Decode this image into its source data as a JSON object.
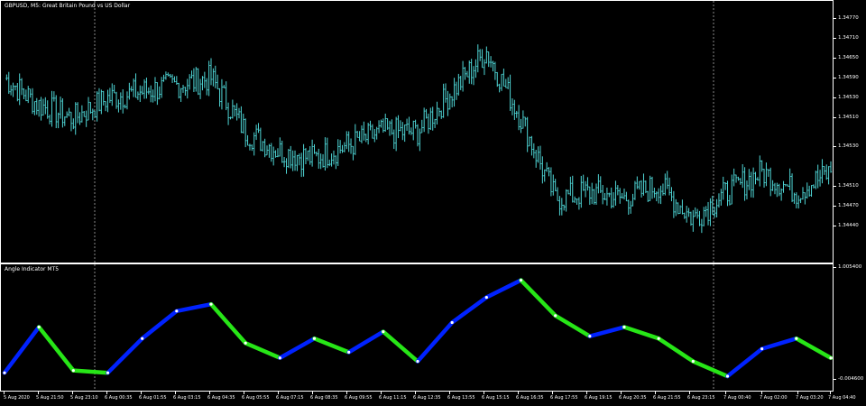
{
  "main_chart": {
    "title": "GBPUSD, M5:  Great Britain Pound vs US Dollar",
    "price_labels": [
      "1.34770",
      "1.34710",
      "1.34650",
      "1.34590",
      "1.34530",
      "1.34510",
      "1.34530",
      "1.34510",
      "1.34470",
      "1.34440"
    ],
    "colors": {
      "candle": "#4fd6d6",
      "background": "#000000",
      "border": "#ffffff",
      "separator": "#c0c0c0"
    }
  },
  "indicator": {
    "title": "Angle Indicator MT5",
    "levels": [
      "1.005400",
      "-0.004600"
    ],
    "colors": {
      "up": "#0022ff",
      "down": "#27e617"
    }
  },
  "time_axis": {
    "labels": [
      "5 Aug 2020",
      "5 Aug 21:50",
      "5 Aug 23:10",
      "6 Aug 00:35",
      "6 Aug 01:55",
      "6 Aug 03:15",
      "6 Aug 04:35",
      "6 Aug 05:55",
      "6 Aug 07:15",
      "6 Aug 08:35",
      "6 Aug 09:55",
      "6 Aug 11:15",
      "6 Aug 12:35",
      "6 Aug 13:55",
      "6 Aug 15:15",
      "6 Aug 16:35",
      "6 Aug 17:55",
      "6 Aug 19:15",
      "6 Aug 20:35",
      "6 Aug 21:55",
      "6 Aug 23:15",
      "7 Aug 00:40",
      "7 Aug 02:00",
      "7 Aug 03:20",
      "7 Aug 04:40"
    ]
  },
  "chart_data": [
    {
      "type": "line",
      "title": "GBPUSD, M5:  Great Britain Pound vs US Dollar",
      "ylim": [
        1.3441,
        1.3479
      ],
      "x": [
        "5 Aug 2020",
        "5 Aug 21:50",
        "5 Aug 23:10",
        "6 Aug 00:35",
        "6 Aug 01:55",
        "6 Aug 03:15",
        "6 Aug 04:35",
        "6 Aug 05:55",
        "6 Aug 07:15",
        "6 Aug 08:35",
        "6 Aug 09:55",
        "6 Aug 11:15",
        "6 Aug 12:35",
        "6 Aug 13:55",
        "6 Aug 15:15",
        "6 Aug 16:35",
        "6 Aug 17:55",
        "6 Aug 19:15",
        "6 Aug 20:35",
        "6 Aug 21:55",
        "6 Aug 23:15",
        "7 Aug 00:40",
        "7 Aug 02:00",
        "7 Aug 03:20",
        "7 Aug 04:40"
      ],
      "series": [
        {
          "values": [
            1.3468,
            1.3464,
            1.3462,
            1.3465,
            1.3466,
            1.3467,
            1.3468,
            1.346,
            1.3457,
            1.3456,
            1.3458,
            1.346,
            1.346,
            1.3466,
            1.3472,
            1.3462,
            1.345,
            1.3451,
            1.345,
            1.3452,
            1.3447,
            1.3451,
            1.3454,
            1.3451,
            1.3454
          ]
        }
      ]
    },
    {
      "type": "line",
      "title": "Angle Indicator MT5",
      "ylim": [
        -0.0046,
        1.0054
      ],
      "x": [
        "5 Aug 2020",
        "5 Aug 21:50",
        "5 Aug 23:10",
        "6 Aug 00:35",
        "6 Aug 01:55",
        "6 Aug 03:15",
        "6 Aug 04:35",
        "6 Aug 05:55",
        "6 Aug 07:15",
        "6 Aug 08:35",
        "6 Aug 09:55",
        "6 Aug 11:15",
        "6 Aug 12:35",
        "6 Aug 13:55",
        "6 Aug 15:15",
        "6 Aug 16:35",
        "6 Aug 17:55",
        "6 Aug 19:15",
        "6 Aug 20:35",
        "6 Aug 21:55",
        "6 Aug 23:15",
        "7 Aug 00:40",
        "7 Aug 02:00",
        "7 Aug 03:20",
        "7 Aug 04:40"
      ],
      "series": [
        {
          "values": [
            0.12,
            0.52,
            0.14,
            0.12,
            0.42,
            0.66,
            0.72,
            0.38,
            0.25,
            0.42,
            0.3,
            0.48,
            0.22,
            0.56,
            0.78,
            0.93,
            0.62,
            0.44,
            0.52,
            0.42,
            0.22,
            0.09,
            0.33,
            0.42,
            0.25
          ]
        }
      ]
    }
  ]
}
